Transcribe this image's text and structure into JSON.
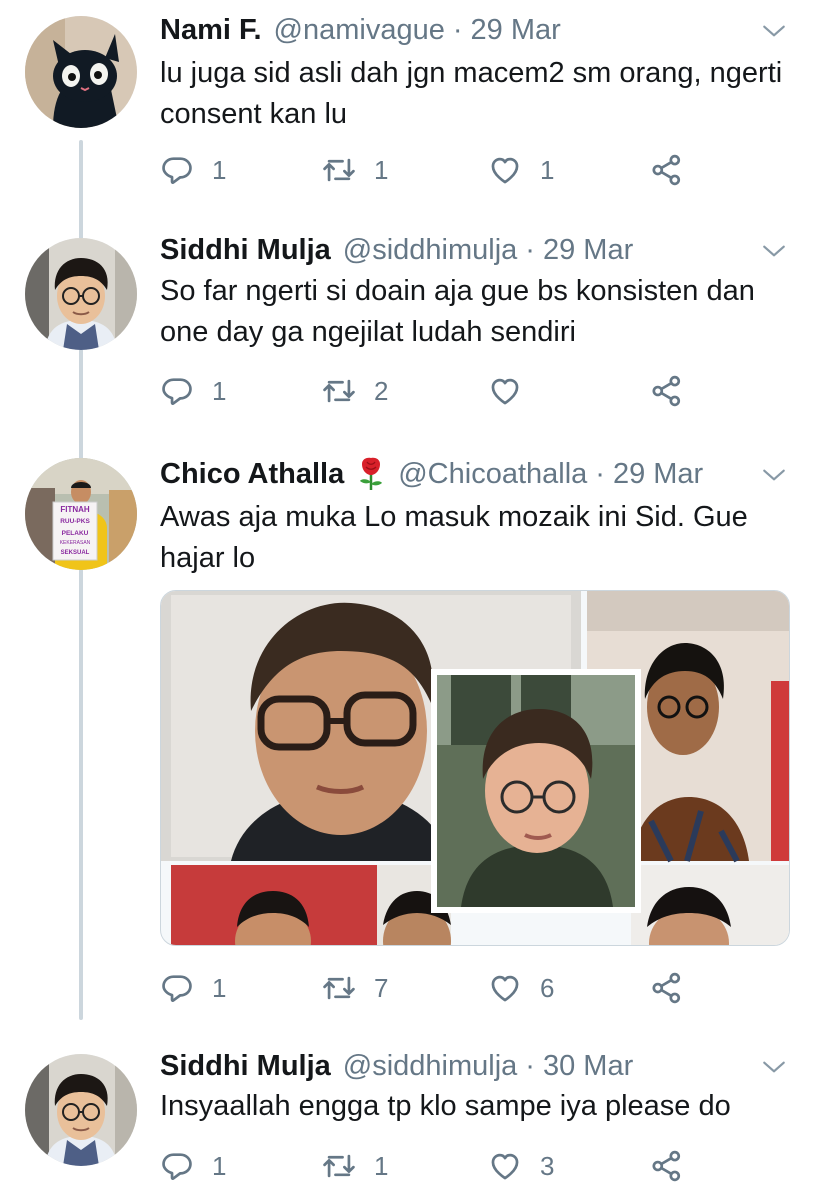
{
  "tweets": [
    {
      "name": "Nami F.",
      "handle": "@namivague",
      "date": "29 Mar",
      "text": "lu juga sid asli dah jgn macem2 sm orang, ngerti consent kan lu",
      "replies": "1",
      "retweets": "1",
      "likes": "1"
    },
    {
      "name": "Siddhi Mulja",
      "handle": "@siddhimulja",
      "date": "29 Mar",
      "text": "So far ngerti si doain aja gue bs konsisten dan one day ga ngejilat ludah sendiri",
      "replies": "1",
      "retweets": "2",
      "likes": ""
    },
    {
      "name": "Chico Athalla",
      "handle": "@Chicoathalla",
      "date": "29 Mar",
      "text": "Awas aja muka Lo masuk mozaik ini Sid. Gue hajar lo",
      "replies": "1",
      "retweets": "7",
      "likes": "6",
      "avatar_sign": [
        "FITNAH",
        "RUU-PKS",
        "PELAKU",
        "KEKERASAN",
        "SEKSUAL"
      ]
    },
    {
      "name": "Siddhi Mulja",
      "handle": "@siddhimulja",
      "date": "30 Mar",
      "text": "Insyaallah engga tp klo sampe iya please do",
      "replies": "1",
      "retweets": "1",
      "likes": "3"
    }
  ],
  "separator": "·",
  "colors": {
    "secondary_text": "#657786",
    "thread_line": "#ccd6dd",
    "primary_text": "#14171a"
  },
  "icons": [
    "reply-icon",
    "retweet-icon",
    "like-icon",
    "share-icon",
    "chevron-down-icon",
    "rose-emoji"
  ]
}
